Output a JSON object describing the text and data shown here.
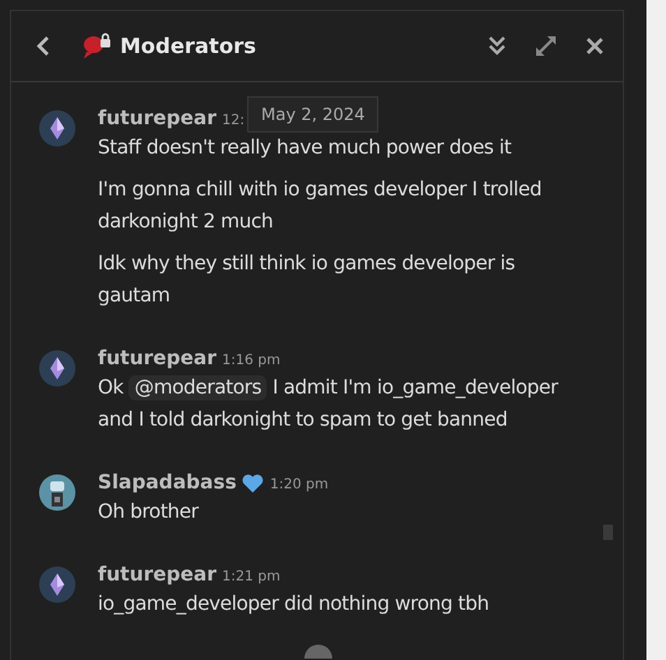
{
  "header": {
    "title": "Moderators"
  },
  "tooltip": "May 2, 2024",
  "groups": [
    {
      "author": "futurepear",
      "time": "12:",
      "kind": "gem",
      "heart": false,
      "messages": [
        [
          {
            "text": "Staff doesn't really have much power does it"
          }
        ],
        [
          {
            "text": "I'm gonna chill with io games developer I trolled darkonight 2 much"
          }
        ],
        [
          {
            "text": "Idk why they still think io games developer is gautam"
          }
        ]
      ]
    },
    {
      "author": "futurepear",
      "time": "1:16 pm",
      "kind": "gem",
      "heart": false,
      "messages": [
        [
          {
            "text": "Ok "
          },
          {
            "mention": "@moderators"
          },
          {
            "text": " I admit I'm io_game_developer and I told darkonight to spam to get banned"
          }
        ]
      ]
    },
    {
      "author": "Slapadabass",
      "time": "1:20 pm",
      "kind": "robot",
      "heart": true,
      "messages": [
        [
          {
            "text": "Oh brother"
          }
        ]
      ]
    },
    {
      "author": "futurepear",
      "time": "1:21 pm",
      "kind": "gem",
      "heart": false,
      "messages": [
        [
          {
            "text": "io_game_developer did nothing wrong tbh"
          }
        ]
      ]
    }
  ]
}
